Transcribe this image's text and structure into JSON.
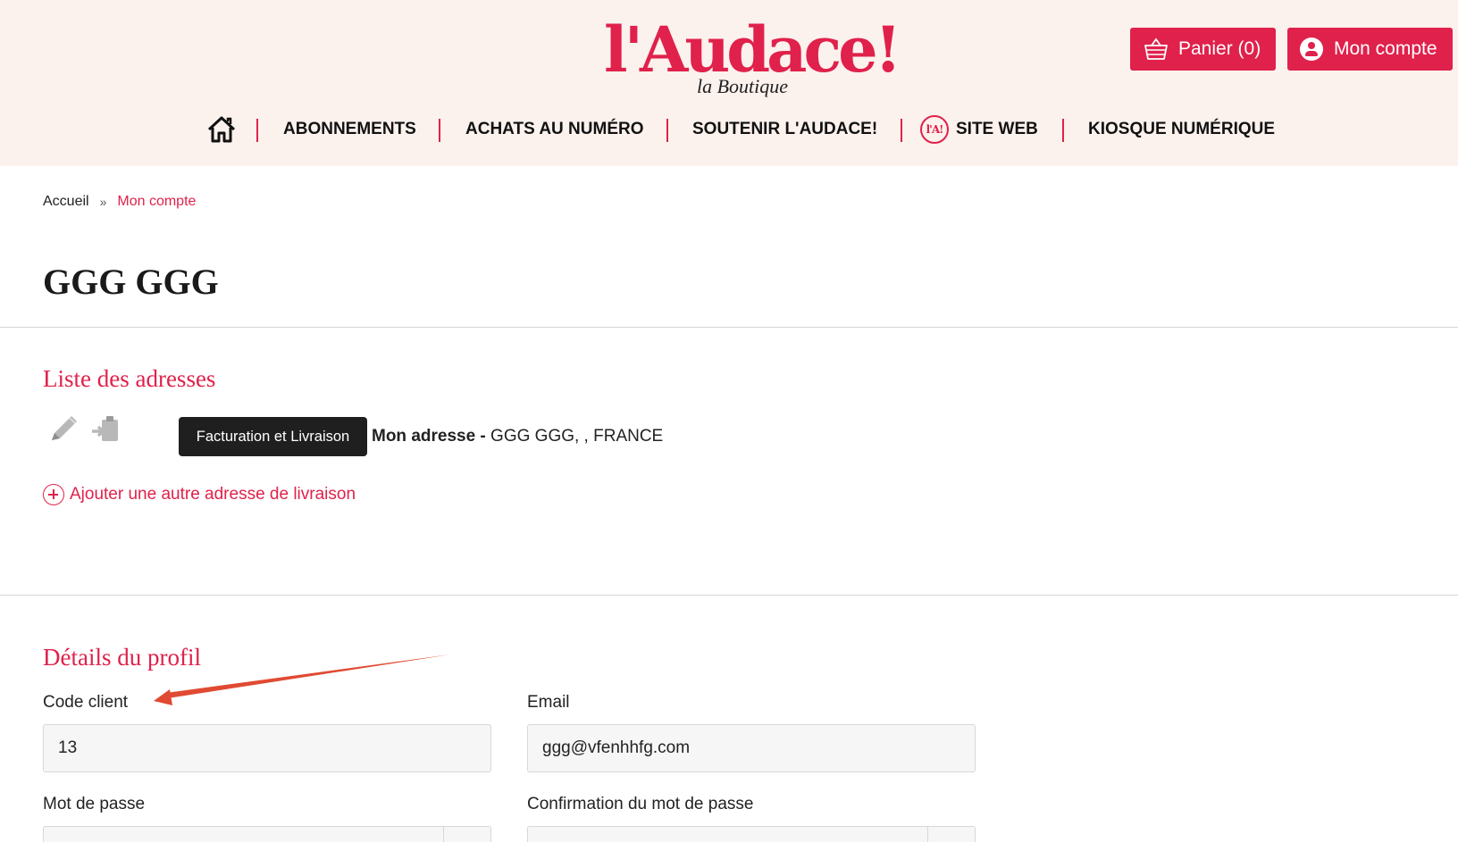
{
  "header": {
    "logo_text": "l'Audace!",
    "logo_subtitle": "la Boutique",
    "cart_label": "Panier (0)",
    "account_label": "Mon compte",
    "nav": [
      {
        "label": "ABONNEMENTS"
      },
      {
        "label": "ACHATS AU NUMÉRO"
      },
      {
        "label": "SOUTENIR L'AUDACE!"
      },
      {
        "label": "SITE WEB",
        "badge": "l'A!"
      },
      {
        "label": "KIOSQUE NUMÉRIQUE"
      }
    ]
  },
  "breadcrumb": {
    "home": "Accueil",
    "separator": "»",
    "current": "Mon compte"
  },
  "page_title": "GGG GGG",
  "addresses": {
    "title": "Liste des adresses",
    "tooltip": "Facturation et Livraison",
    "address_name": "Mon adresse -",
    "address_value": "GGG GGG, , FRANCE",
    "add_label": "Ajouter une autre adresse de livraison"
  },
  "profile": {
    "title": "Détails du profil",
    "client_code_label": "Code client",
    "client_code_value": "13",
    "email_label": "Email",
    "email_value": "ggg@vfenhhfg.com",
    "password_label": "Mot de passe",
    "password_confirm_label": "Confirmation du mot de passe"
  },
  "colors": {
    "brand": "#e0214b",
    "header_bg": "#fbf1ed",
    "annotation_arrow": "#e04a33"
  },
  "icons": [
    "cart-icon",
    "account-icon",
    "home-icon",
    "edit-icon",
    "delete-icon",
    "add-circle-icon",
    "annotation-arrow"
  ]
}
